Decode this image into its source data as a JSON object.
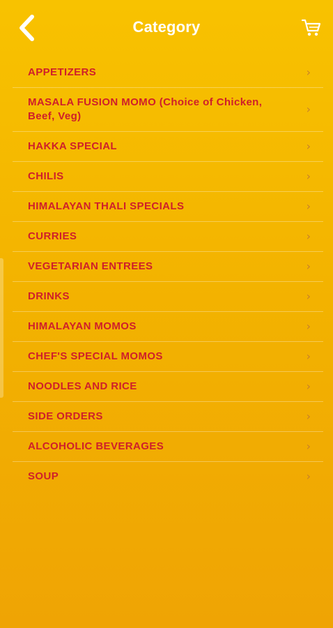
{
  "header": {
    "title": "Category",
    "back_icon": "chevron-left-icon",
    "cart_icon": "cart-icon"
  },
  "colors": {
    "background_top": "#f8c200",
    "background_bottom": "#efa404",
    "item_text": "#cf1f2a",
    "title_text": "#ffffff"
  },
  "categories": [
    {
      "label": "APPETIZERS"
    },
    {
      "label": "MASALA FUSION MOMO (Choice of Chicken, Beef, Veg)"
    },
    {
      "label": "HAKKA SPECIAL"
    },
    {
      "label": "CHILIS"
    },
    {
      "label": "HIMALAYAN THALI SPECIALS"
    },
    {
      "label": "CURRIES"
    },
    {
      "label": "VEGETARIAN ENTREES"
    },
    {
      "label": "DRINKS"
    },
    {
      "label": "HIMALAYAN MOMOS"
    },
    {
      "label": "CHEF'S SPECIAL MOMOS"
    },
    {
      "label": "NOODLES AND RICE"
    },
    {
      "label": "SIDE ORDERS"
    },
    {
      "label": "ALCOHOLIC BEVERAGES"
    },
    {
      "label": "SOUP"
    }
  ]
}
